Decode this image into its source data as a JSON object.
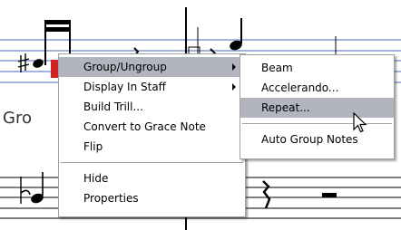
{
  "staff_text": "Gro",
  "main_menu": {
    "items": [
      {
        "label": "Group/Ungroup",
        "submenu": true,
        "highlighted": true
      },
      {
        "label": "Display In Staff",
        "submenu": true
      },
      {
        "label": "Build Trill..."
      },
      {
        "label": "Convert to Grace Note"
      },
      {
        "label": "Flip"
      },
      {
        "label": "Hide"
      },
      {
        "label": "Properties"
      }
    ]
  },
  "sub_menu": {
    "items": [
      {
        "label": "Beam"
      },
      {
        "label": "Accelerando..."
      },
      {
        "label": "Repeat...",
        "highlighted": true
      },
      {
        "label": "Auto Group Notes"
      }
    ]
  },
  "colors": {
    "staff_line": "#4060c0",
    "highlight": "#b2b4bf",
    "selected_note": "#d02020"
  }
}
